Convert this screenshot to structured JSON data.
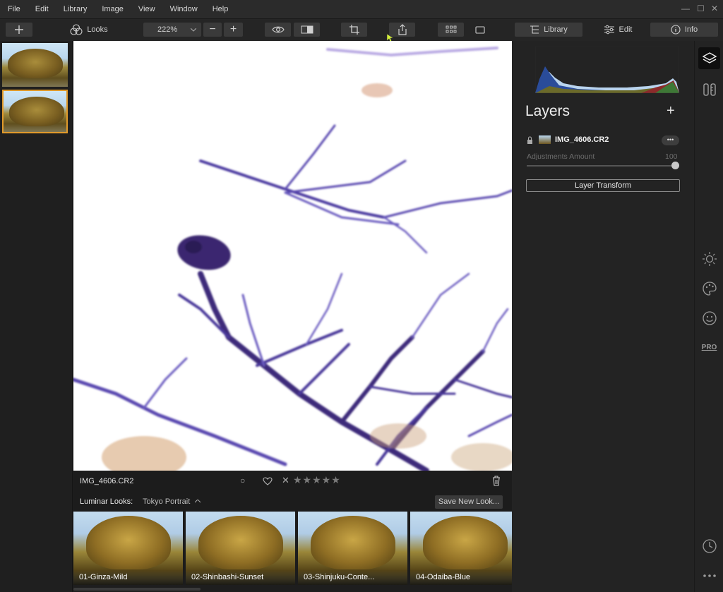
{
  "menubar": {
    "items": [
      "File",
      "Edit",
      "Library",
      "Image",
      "View",
      "Window",
      "Help"
    ],
    "window_controls": {
      "minimize": "—",
      "maximize": "☐",
      "close": "✕"
    }
  },
  "toolbar": {
    "add_icon": "plus-icon",
    "looks_label": "Looks",
    "zoom_value": "222%",
    "zoom_out": "−",
    "zoom_in": "+",
    "library_label": "Library",
    "edit_label": "Edit",
    "info_label": "Info"
  },
  "infobar": {
    "filename": "IMG_4606.CR2",
    "stars": "★★★★★",
    "reject": "✕",
    "flag": "○"
  },
  "looks": {
    "label": "Luminar Looks:",
    "collection": "Tokyo Portrait",
    "save_button": "Save New Look...",
    "items": [
      {
        "name": "01-Ginza-Mild"
      },
      {
        "name": "02-Shinbashi-Sunset"
      },
      {
        "name": "03-Shinjuku-Conte..."
      },
      {
        "name": "04-Odaiba-Blue"
      }
    ]
  },
  "layers": {
    "title": "Layers",
    "add": "+",
    "layer_name": "IMG_4606.CR2",
    "more": "•••",
    "adjustments_label": "Adjustments Amount",
    "adjustments_value": "100",
    "transform_button": "Layer Transform"
  },
  "rail": {
    "pro_label": "PRO"
  },
  "colors": {
    "accent": "#e09a2b",
    "panel": "#232323",
    "button": "#3a3a3a"
  }
}
